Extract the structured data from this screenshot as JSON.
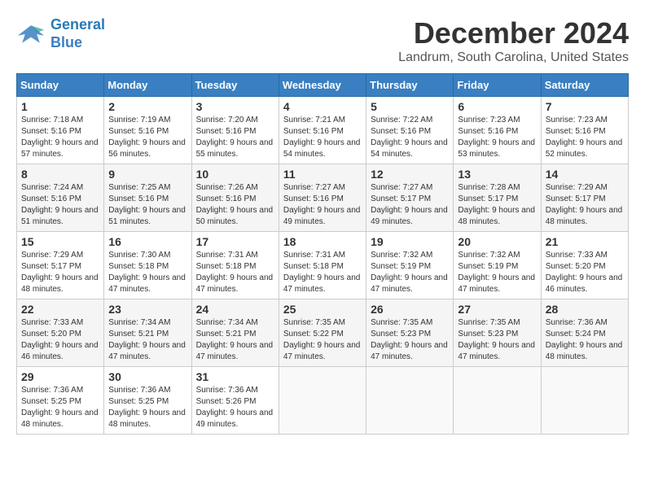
{
  "header": {
    "logo_line1": "General",
    "logo_line2": "Blue",
    "month": "December 2024",
    "location": "Landrum, South Carolina, United States"
  },
  "days_of_week": [
    "Sunday",
    "Monday",
    "Tuesday",
    "Wednesday",
    "Thursday",
    "Friday",
    "Saturday"
  ],
  "weeks": [
    [
      {
        "day": "1",
        "sunrise": "Sunrise: 7:18 AM",
        "sunset": "Sunset: 5:16 PM",
        "daylight": "Daylight: 9 hours and 57 minutes."
      },
      {
        "day": "2",
        "sunrise": "Sunrise: 7:19 AM",
        "sunset": "Sunset: 5:16 PM",
        "daylight": "Daylight: 9 hours and 56 minutes."
      },
      {
        "day": "3",
        "sunrise": "Sunrise: 7:20 AM",
        "sunset": "Sunset: 5:16 PM",
        "daylight": "Daylight: 9 hours and 55 minutes."
      },
      {
        "day": "4",
        "sunrise": "Sunrise: 7:21 AM",
        "sunset": "Sunset: 5:16 PM",
        "daylight": "Daylight: 9 hours and 54 minutes."
      },
      {
        "day": "5",
        "sunrise": "Sunrise: 7:22 AM",
        "sunset": "Sunset: 5:16 PM",
        "daylight": "Daylight: 9 hours and 54 minutes."
      },
      {
        "day": "6",
        "sunrise": "Sunrise: 7:23 AM",
        "sunset": "Sunset: 5:16 PM",
        "daylight": "Daylight: 9 hours and 53 minutes."
      },
      {
        "day": "7",
        "sunrise": "Sunrise: 7:23 AM",
        "sunset": "Sunset: 5:16 PM",
        "daylight": "Daylight: 9 hours and 52 minutes."
      }
    ],
    [
      {
        "day": "8",
        "sunrise": "Sunrise: 7:24 AM",
        "sunset": "Sunset: 5:16 PM",
        "daylight": "Daylight: 9 hours and 51 minutes."
      },
      {
        "day": "9",
        "sunrise": "Sunrise: 7:25 AM",
        "sunset": "Sunset: 5:16 PM",
        "daylight": "Daylight: 9 hours and 51 minutes."
      },
      {
        "day": "10",
        "sunrise": "Sunrise: 7:26 AM",
        "sunset": "Sunset: 5:16 PM",
        "daylight": "Daylight: 9 hours and 50 minutes."
      },
      {
        "day": "11",
        "sunrise": "Sunrise: 7:27 AM",
        "sunset": "Sunset: 5:16 PM",
        "daylight": "Daylight: 9 hours and 49 minutes."
      },
      {
        "day": "12",
        "sunrise": "Sunrise: 7:27 AM",
        "sunset": "Sunset: 5:17 PM",
        "daylight": "Daylight: 9 hours and 49 minutes."
      },
      {
        "day": "13",
        "sunrise": "Sunrise: 7:28 AM",
        "sunset": "Sunset: 5:17 PM",
        "daylight": "Daylight: 9 hours and 48 minutes."
      },
      {
        "day": "14",
        "sunrise": "Sunrise: 7:29 AM",
        "sunset": "Sunset: 5:17 PM",
        "daylight": "Daylight: 9 hours and 48 minutes."
      }
    ],
    [
      {
        "day": "15",
        "sunrise": "Sunrise: 7:29 AM",
        "sunset": "Sunset: 5:17 PM",
        "daylight": "Daylight: 9 hours and 48 minutes."
      },
      {
        "day": "16",
        "sunrise": "Sunrise: 7:30 AM",
        "sunset": "Sunset: 5:18 PM",
        "daylight": "Daylight: 9 hours and 47 minutes."
      },
      {
        "day": "17",
        "sunrise": "Sunrise: 7:31 AM",
        "sunset": "Sunset: 5:18 PM",
        "daylight": "Daylight: 9 hours and 47 minutes."
      },
      {
        "day": "18",
        "sunrise": "Sunrise: 7:31 AM",
        "sunset": "Sunset: 5:18 PM",
        "daylight": "Daylight: 9 hours and 47 minutes."
      },
      {
        "day": "19",
        "sunrise": "Sunrise: 7:32 AM",
        "sunset": "Sunset: 5:19 PM",
        "daylight": "Daylight: 9 hours and 47 minutes."
      },
      {
        "day": "20",
        "sunrise": "Sunrise: 7:32 AM",
        "sunset": "Sunset: 5:19 PM",
        "daylight": "Daylight: 9 hours and 47 minutes."
      },
      {
        "day": "21",
        "sunrise": "Sunrise: 7:33 AM",
        "sunset": "Sunset: 5:20 PM",
        "daylight": "Daylight: 9 hours and 46 minutes."
      }
    ],
    [
      {
        "day": "22",
        "sunrise": "Sunrise: 7:33 AM",
        "sunset": "Sunset: 5:20 PM",
        "daylight": "Daylight: 9 hours and 46 minutes."
      },
      {
        "day": "23",
        "sunrise": "Sunrise: 7:34 AM",
        "sunset": "Sunset: 5:21 PM",
        "daylight": "Daylight: 9 hours and 47 minutes."
      },
      {
        "day": "24",
        "sunrise": "Sunrise: 7:34 AM",
        "sunset": "Sunset: 5:21 PM",
        "daylight": "Daylight: 9 hours and 47 minutes."
      },
      {
        "day": "25",
        "sunrise": "Sunrise: 7:35 AM",
        "sunset": "Sunset: 5:22 PM",
        "daylight": "Daylight: 9 hours and 47 minutes."
      },
      {
        "day": "26",
        "sunrise": "Sunrise: 7:35 AM",
        "sunset": "Sunset: 5:23 PM",
        "daylight": "Daylight: 9 hours and 47 minutes."
      },
      {
        "day": "27",
        "sunrise": "Sunrise: 7:35 AM",
        "sunset": "Sunset: 5:23 PM",
        "daylight": "Daylight: 9 hours and 47 minutes."
      },
      {
        "day": "28",
        "sunrise": "Sunrise: 7:36 AM",
        "sunset": "Sunset: 5:24 PM",
        "daylight": "Daylight: 9 hours and 48 minutes."
      }
    ],
    [
      {
        "day": "29",
        "sunrise": "Sunrise: 7:36 AM",
        "sunset": "Sunset: 5:25 PM",
        "daylight": "Daylight: 9 hours and 48 minutes."
      },
      {
        "day": "30",
        "sunrise": "Sunrise: 7:36 AM",
        "sunset": "Sunset: 5:25 PM",
        "daylight": "Daylight: 9 hours and 48 minutes."
      },
      {
        "day": "31",
        "sunrise": "Sunrise: 7:36 AM",
        "sunset": "Sunset: 5:26 PM",
        "daylight": "Daylight: 9 hours and 49 minutes."
      },
      null,
      null,
      null,
      null
    ]
  ]
}
